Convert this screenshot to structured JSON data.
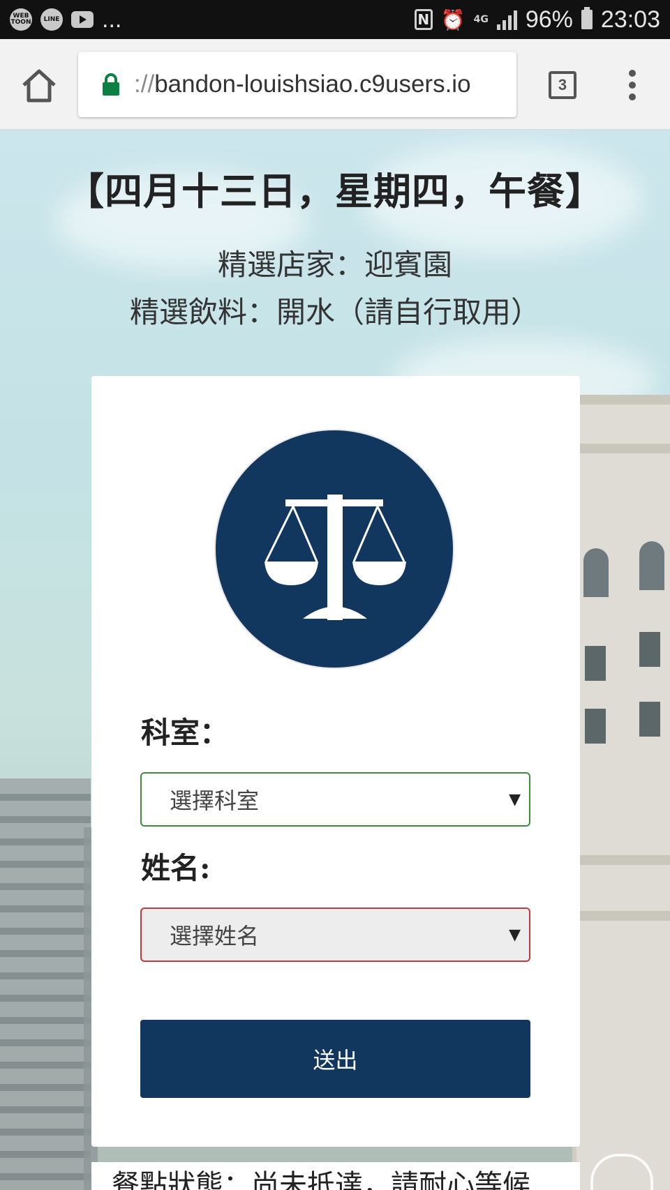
{
  "status_bar": {
    "app_icons": [
      "webtoon-icon",
      "line-icon",
      "youtube-icon"
    ],
    "webtoon_label": "WEB TOON",
    "line_label": "LINE",
    "more": "...",
    "nfc": "N",
    "network": "4G",
    "battery": "96%",
    "time": "23:03"
  },
  "browser": {
    "url_prefix": "://",
    "url_host": "bandon-louishsiao.c9users.io",
    "tab_count": "3"
  },
  "page": {
    "title": "【四月十三日，星期四，午餐】",
    "store_line": "精選店家：迎賓園",
    "drink_line": "精選飲料：開水（請自行取用）",
    "form": {
      "dept_label": "科室：",
      "dept_select": "選擇科室",
      "name_label": "姓名:",
      "name_select": "選擇姓名",
      "submit": "送出"
    },
    "meal_status": "餐點狀態：尚未抵達，請耐心等候"
  },
  "colors": {
    "brand_navy": "#11375f",
    "dept_border": "#3c8b3f",
    "name_border": "#c0393b",
    "lock_green": "#0b8043"
  }
}
